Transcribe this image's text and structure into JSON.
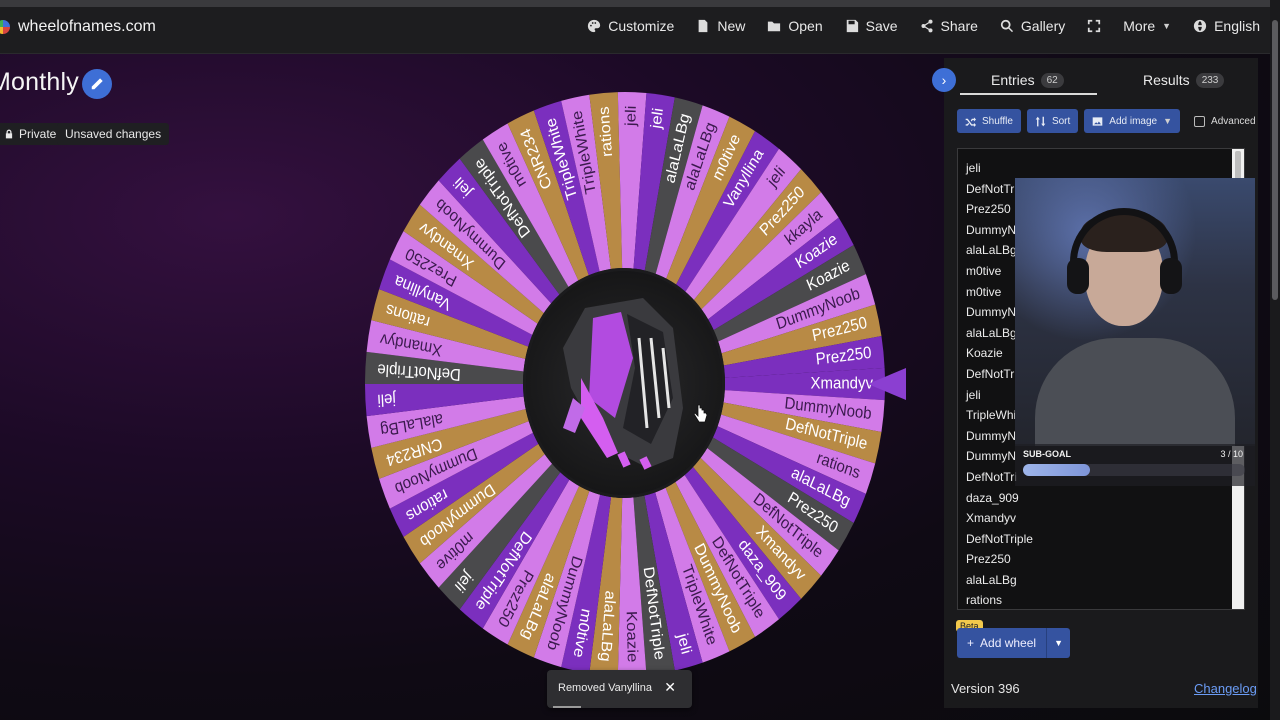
{
  "header": {
    "brand": "wheelofnames.com",
    "menu": [
      {
        "label": "Customize",
        "icon": "palette-icon"
      },
      {
        "label": "New",
        "icon": "file-icon"
      },
      {
        "label": "Open",
        "icon": "folder-icon"
      },
      {
        "label": "Save",
        "icon": "save-icon"
      },
      {
        "label": "Share",
        "icon": "share-icon"
      },
      {
        "label": "Gallery",
        "icon": "search-icon"
      },
      {
        "label": "",
        "icon": "fullscreen-icon"
      },
      {
        "label": "More",
        "icon": "caret-down-icon"
      },
      {
        "label": "English",
        "icon": "globe-icon"
      }
    ]
  },
  "wheel_title": "Monthly",
  "chips": {
    "privacy": "Private",
    "status": "Unsaved changes"
  },
  "wheel": {
    "colors": {
      "purple": "#7b2fbe",
      "pink": "#d27be8",
      "gold": "#b88a45",
      "dark": "#4a4a4c"
    },
    "labels": [
      "Xmandyv",
      "DummyNoob",
      "DefNotTriple",
      "rations",
      "alaLaLBg",
      "Prez250",
      "DefNotTriple",
      "Xmandyv",
      "daza_909",
      "DefNotTriple",
      "DummyNoob",
      "TripleWhite",
      "jeli",
      "DefNotTriple",
      "Koazie",
      "alaLaLBg",
      "m0tive",
      "DummyNoob",
      "alaLaLBg",
      "Prez250",
      "DefNotTriple",
      "jeli",
      "m0tive",
      "DummyNoob",
      "rations",
      "DummyNoob",
      "CNR234",
      "alaLaLBg",
      "jeli",
      "DefNotTriple",
      "Xmandyv",
      "rations",
      "Vanyllina",
      "Prez250",
      "Xmandyv",
      "DummyNoob",
      "jeli",
      "DefNotTriple",
      "m0tive",
      "CNR234",
      "TripleWhite",
      "TripleWhite",
      "rations",
      "jeli",
      "jeli",
      "alaLaLBg",
      "alaLaLBg",
      "m0tive",
      "Vanyllina",
      "jeli",
      "Prez250",
      "kkayla",
      "Koazie",
      "Koazie",
      "DummyNoob",
      "Prez250",
      "Prez250"
    ]
  },
  "panel": {
    "tabs": [
      {
        "label": "Entries",
        "count": "62"
      },
      {
        "label": "Results",
        "count": "233"
      }
    ],
    "toolbar": {
      "shuffle": "Shuffle",
      "sort": "Sort",
      "add_image": "Add image",
      "advanced": "Advanced"
    },
    "entries": [
      "jeli",
      "DefNotTri",
      "Prez250",
      "DummyN",
      "alaLaLBg",
      "m0tive",
      "m0tive",
      "DummyN",
      "alaLaLBg",
      "Koazie",
      "DefNotTri",
      "jeli",
      "TripleWhi",
      "DummyN",
      "DummyN",
      "DefNotTri",
      "daza_909",
      "Xmandyv",
      "DefNotTriple",
      "Prez250",
      "alaLaLBg",
      "rations"
    ],
    "beta": "Beta",
    "add_wheel": "Add wheel",
    "version": "Version 396",
    "changelog": "Changelog"
  },
  "stream_overlay": {
    "label": "SUB-GOAL",
    "count": "3 / 10",
    "progress": 0.3
  },
  "toast": {
    "message": "Removed Vanyllina",
    "close": "✕"
  }
}
